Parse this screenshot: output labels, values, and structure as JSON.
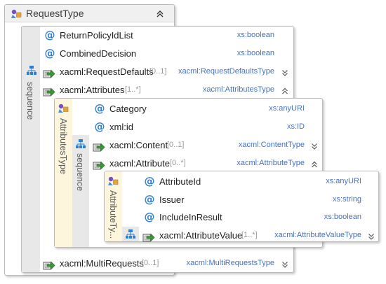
{
  "root": {
    "title": "RequestType"
  },
  "outer_sequence": {
    "label": "sequence",
    "rows": [
      {
        "kind": "attribute",
        "name": "ReturnPolicyIdList",
        "type": "xs:boolean"
      },
      {
        "kind": "attribute",
        "name": "CombinedDecision",
        "type": "xs:boolean"
      },
      {
        "kind": "element",
        "name": "xacml:RequestDefaults",
        "cardinality": "[0..1]",
        "type": "xacml:RequestDefaultsType",
        "state": "collapsed"
      },
      {
        "kind": "element",
        "name": "xacml:Attributes",
        "cardinality": "[1..*]",
        "type": "xacml:AttributesType",
        "state": "expanded"
      },
      {
        "kind": "element",
        "name": "xacml:MultiRequests",
        "cardinality": "[0..1]",
        "type": "xacml:MultiRequestsType",
        "state": "collapsed"
      }
    ]
  },
  "attributes_type": {
    "label": "AttributesType",
    "sequence_label": "sequence",
    "rows": [
      {
        "kind": "attribute",
        "name": "Category",
        "type": "xs:anyURI"
      },
      {
        "kind": "attribute",
        "name": "xml:id",
        "type": "xs:ID"
      },
      {
        "kind": "element",
        "name": "xacml:Content",
        "cardinality": "[0..1]",
        "type": "xacml:ContentType",
        "state": "collapsed"
      },
      {
        "kind": "element",
        "name": "xacml:Attribute",
        "cardinality": "[0..*]",
        "type": "xacml:AttributeType",
        "state": "expanded"
      }
    ]
  },
  "attribute_type": {
    "label": "AttributeTy...",
    "rows": [
      {
        "kind": "attribute",
        "name": "AttributeId",
        "type": "xs:anyURI"
      },
      {
        "kind": "attribute",
        "name": "Issuer",
        "type": "xs:string"
      },
      {
        "kind": "attribute",
        "name": "IncludeInResult",
        "type": "xs:boolean"
      },
      {
        "kind": "element",
        "name": "xacml:AttributeValue",
        "cardinality": "[1..*]",
        "type": "xacml:AttributeValueType",
        "state": "collapsed"
      }
    ]
  },
  "colors": {
    "type_text": "#4472c4",
    "attribute_icon": "#2e7fd6",
    "element_arrow": "#3a9a3a",
    "type_panel": "#fdf6dd",
    "sequence_panel": "#e8e8e8"
  }
}
